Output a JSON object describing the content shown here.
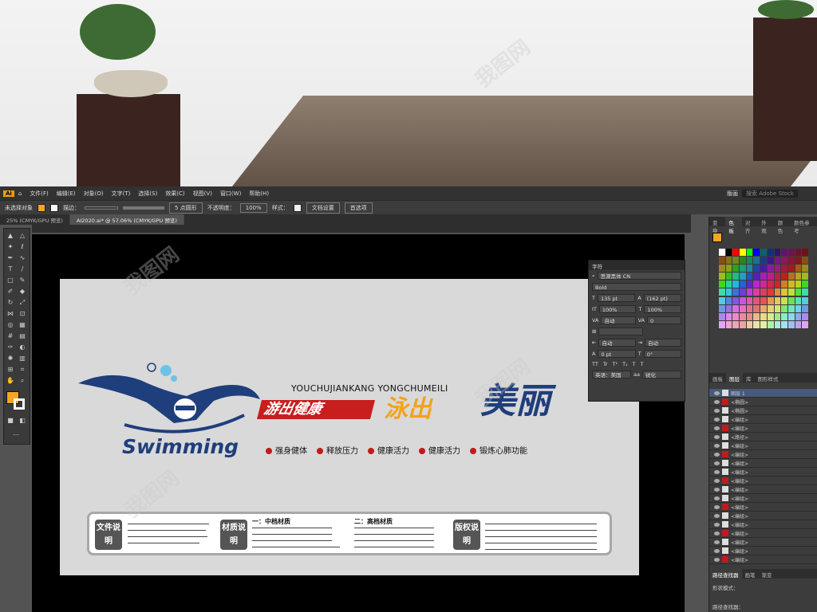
{
  "app": {
    "logo": "Ai",
    "menu": [
      "文件(F)",
      "编辑(E)",
      "对象(O)",
      "文字(T)",
      "选择(S)",
      "效果(C)",
      "视图(V)",
      "窗口(W)",
      "帮助(H)"
    ],
    "workspace": "版画",
    "search_placeholder": "搜索 Adobe Stock"
  },
  "control_bar": {
    "no_selection": "未选择对象",
    "stroke_label": "描边：",
    "brush": "5 点圆形",
    "opacity_label": "不透明度：",
    "opacity_value": "100%",
    "style_label": "样式：",
    "doc_settings": "文档设置",
    "prefs": "首选项"
  },
  "tabs": [
    {
      "label": "25% (CMYK/GPU 预览)",
      "active": false
    },
    {
      "label": "AI2020.ai* @ 57.06% (CMYK/GPU 预览)",
      "active": true
    }
  ],
  "artwork": {
    "pinyin": "YOUCHUJIANKANG YONGCHUMEILI",
    "slogan_red": "游出健康",
    "slogan_yellow": "泳出",
    "slogan_blue": "美丽",
    "brand": "Swimming",
    "bullets": [
      "强身健体",
      "释放压力",
      "健康活力",
      "健康活力",
      "锻炼心肺功能"
    ],
    "info": {
      "file_label": "文件说明",
      "material_label": "材质说明",
      "mid_title": "一：中档材质",
      "high_title": "二：高档材质",
      "copyright_label": "版权说明"
    }
  },
  "character_panel": {
    "title": "字符",
    "font": "思源黑体 CN",
    "style": "Bold",
    "size": "135 pt",
    "leading": "(162 pt)",
    "scale_v": "100%",
    "scale_h": "100%",
    "tracking": "自动",
    "kerning": "0",
    "auto1": "自动",
    "auto2": "自动",
    "baseline": "0 pt",
    "rotate": "0°",
    "language": "英语：美国",
    "aa": "锐化"
  },
  "right_panel": {
    "tabs1": [
      "变换",
      "色板",
      "对齐",
      "外观",
      "颜色",
      "颜色参考"
    ],
    "tabs2": [
      "画板",
      "图层",
      "库",
      "图形样式"
    ],
    "layers": [
      "图层 1",
      "<椭圆>",
      "<椭圆>",
      "<编组>",
      "<编组>",
      "<路径>",
      "<编组>",
      "<编组>",
      "<编组>",
      "<编组>",
      "<编组>",
      "<编组>",
      "<编组>",
      "<编组>",
      "<编组>",
      "<编组>",
      "<编组>",
      "<编组>",
      "<编组>",
      "<编组>"
    ],
    "tabs3": [
      "路径查找器",
      "画笔",
      "渐变"
    ],
    "shape_mode": "形状模式：",
    "pathfinder": "路径查找器："
  },
  "watermark": "我图网",
  "colors": {
    "red": "#c81e1e",
    "yellow": "#f2a31b",
    "blue": "#1f3e7c",
    "accent": "#f6a623"
  }
}
